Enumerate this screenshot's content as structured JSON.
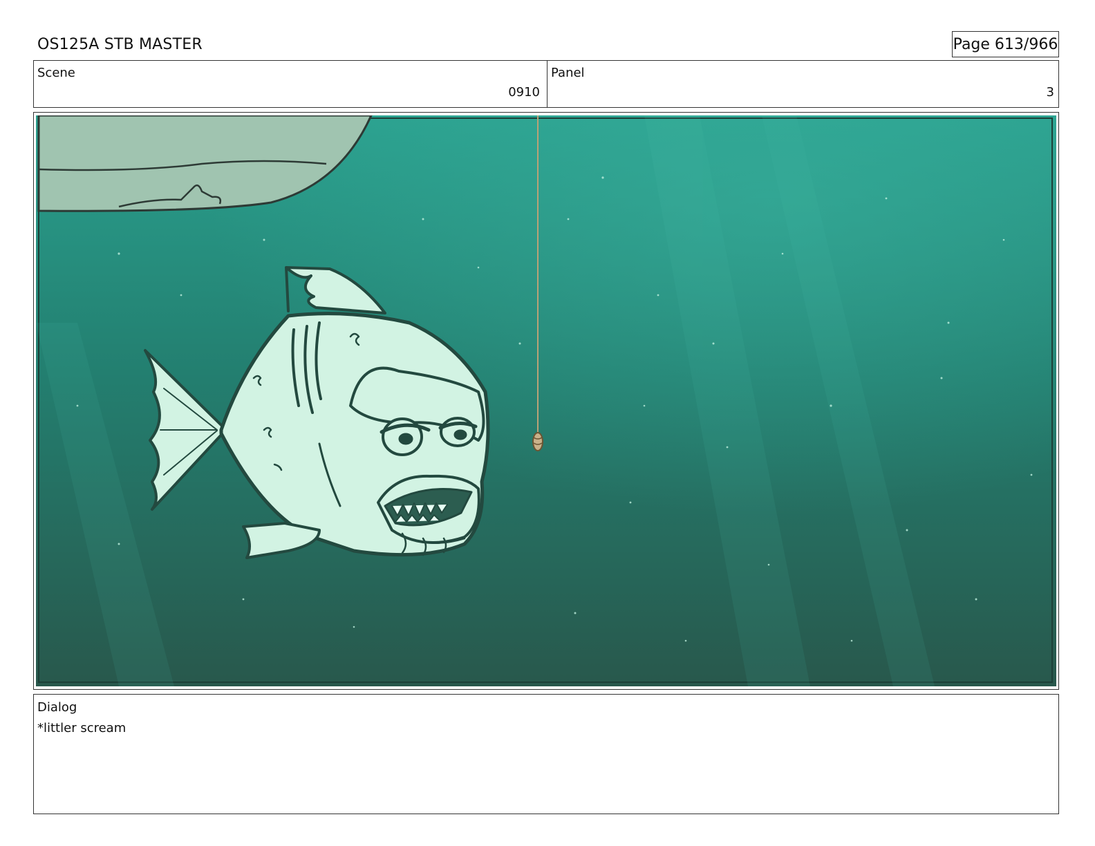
{
  "header": {
    "title": "OS125A STB MASTER",
    "page": "Page 613/966"
  },
  "info": {
    "scene_label": "Scene",
    "scene_value": "0910",
    "panel_label": "Panel",
    "panel_value": "3"
  },
  "frame": {
    "description_icon": "storyboard-panel-image",
    "colors": {
      "water_light": "#2aa08e",
      "water_dark": "#28584c",
      "fish_fill": "#d2f3e3",
      "fish_line": "#23493f",
      "rock_fill": "#a0c4b0"
    }
  },
  "dialog": {
    "label": "Dialog",
    "text": "*littler scream"
  }
}
